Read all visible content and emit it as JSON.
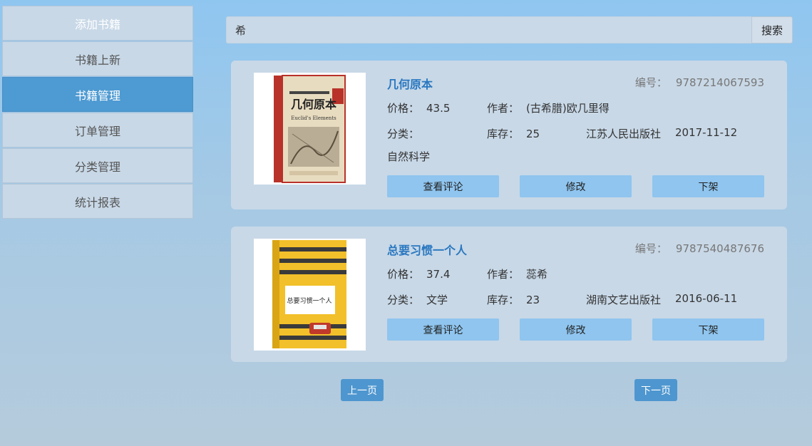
{
  "sidebar": {
    "items": [
      {
        "label": "添加书籍"
      },
      {
        "label": "书籍上新"
      },
      {
        "label": "书籍管理"
      },
      {
        "label": "订单管理"
      },
      {
        "label": "分类管理"
      },
      {
        "label": "统计报表"
      }
    ],
    "active_index": 2
  },
  "search": {
    "value": "希",
    "button_label": "搜索"
  },
  "labels": {
    "isbn": "编号：",
    "price": "价格：",
    "author": "作者：",
    "category": "分类：",
    "stock": "库存："
  },
  "books": [
    {
      "title": "几何原本",
      "isbn": "9787214067593",
      "price": "43.5",
      "author": "(古希腊)欧几里得",
      "category": "",
      "stock": "25",
      "publisher": "江苏人民出版社",
      "date": "2017-11-12",
      "extra": "自然科学",
      "cover_text": "几何原本",
      "cover_sub": "Euclid's Elements",
      "buttons": {
        "reviews": "查看评论",
        "edit": "修改",
        "remove": "下架"
      }
    },
    {
      "title": "总要习惯一个人",
      "isbn": "9787540487676",
      "price": "37.4",
      "author": "蕊希",
      "category": "文学",
      "stock": "23",
      "publisher": "湖南文艺出版社",
      "date": "2016-06-11",
      "cover_text": "总要习惯一个人",
      "buttons": {
        "reviews": "查看评论",
        "edit": "修改",
        "remove": "下架"
      }
    }
  ],
  "pagination": {
    "prev_label": "上一页",
    "next_label": "下一页"
  },
  "colors": {
    "accent": "#4e9ad2",
    "button": "#8fc5ef",
    "title": "#2a78c0"
  }
}
